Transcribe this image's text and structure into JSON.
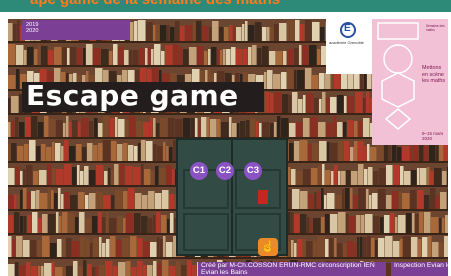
{
  "header": {
    "title_fragment": "ape game de la semaine des maths"
  },
  "year_banner": {
    "line1": "2019",
    "line2": "2020",
    "line3": "année des",
    "line4": "mathématiques"
  },
  "academie": {
    "name": "académie Grenoble",
    "sub": "Région académique Auvergne-Rhône-Alpes"
  },
  "poster": {
    "small": "Semaine des maths",
    "text": "Mettons en scène les maths",
    "dates": "9–15 mars 2020"
  },
  "main": {
    "title": "Escape game"
  },
  "door": {
    "buttons": [
      "C1",
      "C2",
      "C3"
    ],
    "hand_icon": "hand-pointer-icon"
  },
  "footer": {
    "credit_left": "Créé par M-Ch.COSSON  ERUN-RMC circonscription IEN Evian les Bains",
    "credit_right": "Inspection Evian les Bains"
  },
  "colors": {
    "teal": "#2e8a78",
    "purple": "#7b3f96",
    "orange": "#ec8a2a",
    "button_purple": "#8b52c2"
  }
}
